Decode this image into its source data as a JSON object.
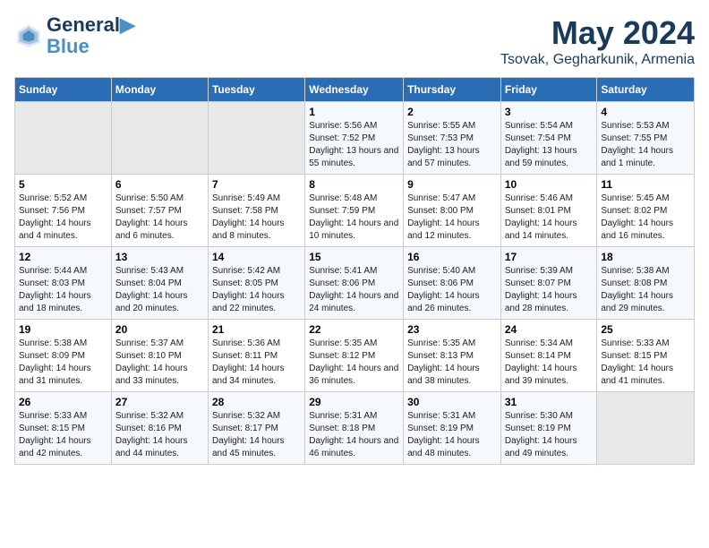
{
  "header": {
    "logo_line1": "General",
    "logo_line2": "Blue",
    "month": "May 2024",
    "location": "Tsovak, Gegharkunik, Armenia"
  },
  "weekdays": [
    "Sunday",
    "Monday",
    "Tuesday",
    "Wednesday",
    "Thursday",
    "Friday",
    "Saturday"
  ],
  "weeks": [
    [
      {
        "day": "",
        "sunrise": "",
        "sunset": "",
        "daylight": "",
        "empty": true
      },
      {
        "day": "",
        "sunrise": "",
        "sunset": "",
        "daylight": "",
        "empty": true
      },
      {
        "day": "",
        "sunrise": "",
        "sunset": "",
        "daylight": "",
        "empty": true
      },
      {
        "day": "1",
        "sunrise": "5:56 AM",
        "sunset": "7:52 PM",
        "daylight": "13 hours and 55 minutes."
      },
      {
        "day": "2",
        "sunrise": "5:55 AM",
        "sunset": "7:53 PM",
        "daylight": "13 hours and 57 minutes."
      },
      {
        "day": "3",
        "sunrise": "5:54 AM",
        "sunset": "7:54 PM",
        "daylight": "13 hours and 59 minutes."
      },
      {
        "day": "4",
        "sunrise": "5:53 AM",
        "sunset": "7:55 PM",
        "daylight": "14 hours and 1 minute."
      }
    ],
    [
      {
        "day": "5",
        "sunrise": "5:52 AM",
        "sunset": "7:56 PM",
        "daylight": "14 hours and 4 minutes."
      },
      {
        "day": "6",
        "sunrise": "5:50 AM",
        "sunset": "7:57 PM",
        "daylight": "14 hours and 6 minutes."
      },
      {
        "day": "7",
        "sunrise": "5:49 AM",
        "sunset": "7:58 PM",
        "daylight": "14 hours and 8 minutes."
      },
      {
        "day": "8",
        "sunrise": "5:48 AM",
        "sunset": "7:59 PM",
        "daylight": "14 hours and 10 minutes."
      },
      {
        "day": "9",
        "sunrise": "5:47 AM",
        "sunset": "8:00 PM",
        "daylight": "14 hours and 12 minutes."
      },
      {
        "day": "10",
        "sunrise": "5:46 AM",
        "sunset": "8:01 PM",
        "daylight": "14 hours and 14 minutes."
      },
      {
        "day": "11",
        "sunrise": "5:45 AM",
        "sunset": "8:02 PM",
        "daylight": "14 hours and 16 minutes."
      }
    ],
    [
      {
        "day": "12",
        "sunrise": "5:44 AM",
        "sunset": "8:03 PM",
        "daylight": "14 hours and 18 minutes."
      },
      {
        "day": "13",
        "sunrise": "5:43 AM",
        "sunset": "8:04 PM",
        "daylight": "14 hours and 20 minutes."
      },
      {
        "day": "14",
        "sunrise": "5:42 AM",
        "sunset": "8:05 PM",
        "daylight": "14 hours and 22 minutes."
      },
      {
        "day": "15",
        "sunrise": "5:41 AM",
        "sunset": "8:06 PM",
        "daylight": "14 hours and 24 minutes."
      },
      {
        "day": "16",
        "sunrise": "5:40 AM",
        "sunset": "8:06 PM",
        "daylight": "14 hours and 26 minutes."
      },
      {
        "day": "17",
        "sunrise": "5:39 AM",
        "sunset": "8:07 PM",
        "daylight": "14 hours and 28 minutes."
      },
      {
        "day": "18",
        "sunrise": "5:38 AM",
        "sunset": "8:08 PM",
        "daylight": "14 hours and 29 minutes."
      }
    ],
    [
      {
        "day": "19",
        "sunrise": "5:38 AM",
        "sunset": "8:09 PM",
        "daylight": "14 hours and 31 minutes."
      },
      {
        "day": "20",
        "sunrise": "5:37 AM",
        "sunset": "8:10 PM",
        "daylight": "14 hours and 33 minutes."
      },
      {
        "day": "21",
        "sunrise": "5:36 AM",
        "sunset": "8:11 PM",
        "daylight": "14 hours and 34 minutes."
      },
      {
        "day": "22",
        "sunrise": "5:35 AM",
        "sunset": "8:12 PM",
        "daylight": "14 hours and 36 minutes."
      },
      {
        "day": "23",
        "sunrise": "5:35 AM",
        "sunset": "8:13 PM",
        "daylight": "14 hours and 38 minutes."
      },
      {
        "day": "24",
        "sunrise": "5:34 AM",
        "sunset": "8:14 PM",
        "daylight": "14 hours and 39 minutes."
      },
      {
        "day": "25",
        "sunrise": "5:33 AM",
        "sunset": "8:15 PM",
        "daylight": "14 hours and 41 minutes."
      }
    ],
    [
      {
        "day": "26",
        "sunrise": "5:33 AM",
        "sunset": "8:15 PM",
        "daylight": "14 hours and 42 minutes."
      },
      {
        "day": "27",
        "sunrise": "5:32 AM",
        "sunset": "8:16 PM",
        "daylight": "14 hours and 44 minutes."
      },
      {
        "day": "28",
        "sunrise": "5:32 AM",
        "sunset": "8:17 PM",
        "daylight": "14 hours and 45 minutes."
      },
      {
        "day": "29",
        "sunrise": "5:31 AM",
        "sunset": "8:18 PM",
        "daylight": "14 hours and 46 minutes."
      },
      {
        "day": "30",
        "sunrise": "5:31 AM",
        "sunset": "8:19 PM",
        "daylight": "14 hours and 48 minutes."
      },
      {
        "day": "31",
        "sunrise": "5:30 AM",
        "sunset": "8:19 PM",
        "daylight": "14 hours and 49 minutes."
      },
      {
        "day": "",
        "sunrise": "",
        "sunset": "",
        "daylight": "",
        "empty": true
      }
    ]
  ]
}
